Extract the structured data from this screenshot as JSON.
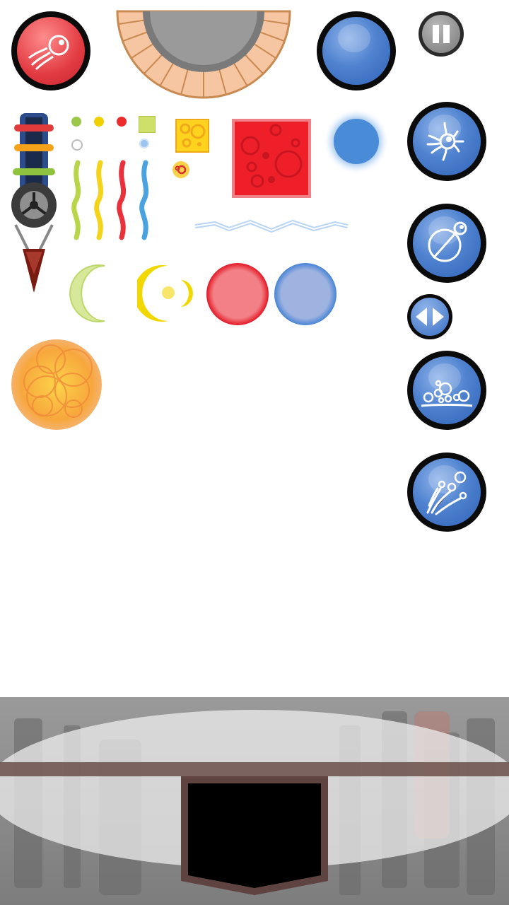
{
  "hud": {
    "fire_button": {
      "icon": "comet-icon",
      "color": "#e53a3e"
    },
    "power_gauge": {
      "icon": "semicircle-gauge-icon",
      "color": "#f6c6a2"
    },
    "charge_button": {
      "icon": "blue-orb-icon",
      "color": "#3a6fc4"
    },
    "pause_button": {
      "icon": "pause-icon",
      "color": "#6b6b6b"
    }
  },
  "sprites": {
    "cannon": {
      "icon": "cannon-turret-icon"
    },
    "small_dots": [
      "#9cc84a",
      "#f1d000",
      "#ee2b2b",
      "#ffffff",
      "#4a90d9"
    ],
    "squiggles": [
      "#b9d64a",
      "#f3d41a",
      "#e8313a",
      "#4aa3e0"
    ],
    "lightning": {
      "color": "#cfe3ff"
    },
    "crescent_colors": [
      "#bcd86a",
      "#f1d800"
    ],
    "bubbles": [
      "#ef4b53",
      "#6d95dd"
    ],
    "explosion": {
      "color": "#f7a73c"
    }
  },
  "side_buttons": [
    {
      "name": "sun-burst",
      "icon": "sunburst-eye-icon"
    },
    {
      "name": "slash-orb",
      "icon": "slashed-orb-icon"
    },
    {
      "name": "direction-toggle",
      "icon": "left-right-arrows-icon"
    },
    {
      "name": "bubble-pile",
      "icon": "bubble-pile-icon"
    },
    {
      "name": "scatter-shot",
      "icon": "scatter-shot-icon"
    }
  ],
  "bottom_panel": {
    "color": "#8a8a8a",
    "slot_color": "#000000"
  }
}
